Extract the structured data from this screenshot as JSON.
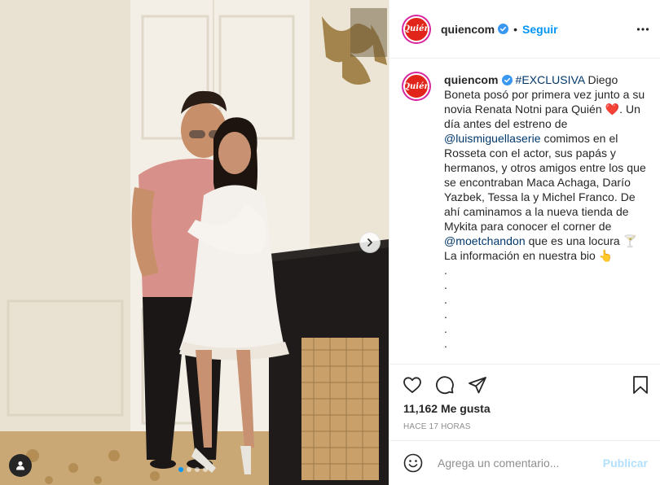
{
  "post": {
    "username": "quiencom",
    "avatar_text": "Quién",
    "follow_label": "Seguir",
    "separator": "•",
    "more_icon": "more-horizontal-icon",
    "brand_color": "#e1251b",
    "accent_color": "#0095f6"
  },
  "caption": {
    "username": "quiencom",
    "hashtag": "#EXCLUSIVA",
    "text1": " Diego Boneta posó por primera vez junto a su novia Renata Notni para Quién ",
    "heart": "❤️",
    "text2": ". Un día antes del estreno de ",
    "mention1": "@luismiguellaserie",
    "text3": " comimos en el Rosseta con el actor, sus papás y hermanos, y otros amigos entre los que se encontraban Maca Achaga, Darío Yazbek, Tessa la y Michel Franco. De ahí caminamos a la nueva tienda de Mykita para conocer el corner de ",
    "mention2": "@moetchandon",
    "text4": " que es una locura ",
    "glass": "🍸",
    "text5": "La información en nuestra bio ",
    "hand": "👆",
    "dots": [
      ".",
      ".",
      ".",
      ".",
      ".",
      "."
    ]
  },
  "actions": {
    "icons": [
      "heart-icon",
      "comment-icon",
      "share-icon",
      "bookmark-icon"
    ],
    "likes": "11,162 Me gusta",
    "time": "HACE 17 HORAS"
  },
  "comment": {
    "placeholder": "Agrega un comentario...",
    "publish_label": "Publicar"
  },
  "carousel": {
    "slide_count": 4,
    "current_slide": 1
  }
}
